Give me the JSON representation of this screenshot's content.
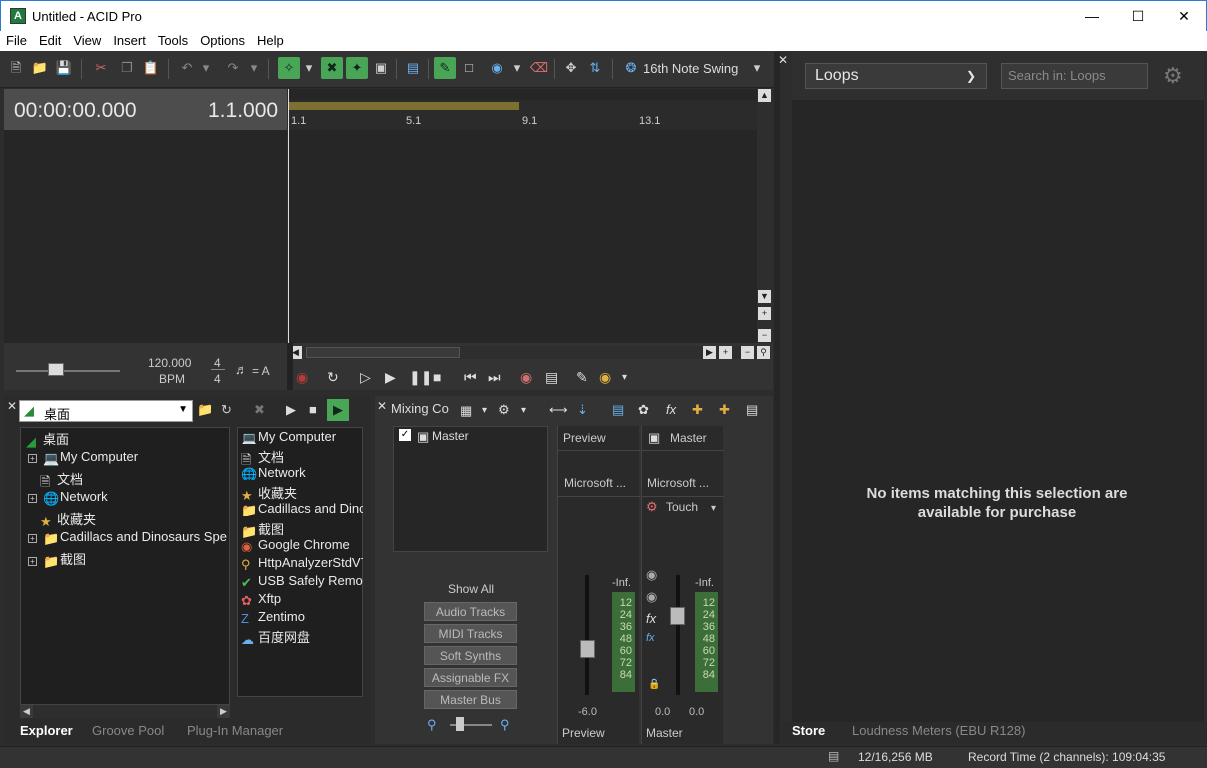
{
  "window": {
    "title": "Untitled - ACID Pro",
    "app_icon": "A"
  },
  "menu": [
    "File",
    "Edit",
    "View",
    "Insert",
    "Tools",
    "Options",
    "Help"
  ],
  "toolbar": {
    "swing_label": "16th Note Swing"
  },
  "timeline": {
    "time": "00:00:00.000",
    "measure": "1.1.000",
    "ruler_labels": [
      "1.1",
      "5.1",
      "9.1",
      "13.1"
    ],
    "tempo": "120.000",
    "tempo_unit": "BPM",
    "time_sig_top": "4",
    "time_sig_bottom": "4",
    "key": "= A"
  },
  "explorer": {
    "location": "桌面",
    "tree": [
      {
        "label": "桌面",
        "icon": "desktop-icon",
        "expand": ""
      },
      {
        "label": "My Computer",
        "icon": "computer-icon",
        "expand": "+"
      },
      {
        "label": "文档",
        "icon": "document-icon",
        "expand": ""
      },
      {
        "label": "Network",
        "icon": "network-icon",
        "expand": "+"
      },
      {
        "label": "收藏夹",
        "icon": "favorites-icon",
        "expand": ""
      },
      {
        "label": "Cadillacs and Dinosaurs Spe",
        "icon": "folder-icon",
        "expand": "+"
      },
      {
        "label": "截图",
        "icon": "folder-icon",
        "expand": "+"
      }
    ],
    "list": [
      {
        "label": "My Computer",
        "icon": "computer-icon"
      },
      {
        "label": "文档",
        "icon": "document-icon"
      },
      {
        "label": "Network",
        "icon": "network-icon"
      },
      {
        "label": "收藏夹",
        "icon": "favorites-icon"
      },
      {
        "label": "Cadillacs and Dinc",
        "icon": "folder-icon"
      },
      {
        "label": "截图",
        "icon": "folder-icon"
      },
      {
        "label": "Google Chrome",
        "icon": "chrome-icon"
      },
      {
        "label": "HttpAnalyzerStdV7",
        "icon": "app-icon"
      },
      {
        "label": "USB Safely Remov",
        "icon": "usb-icon"
      },
      {
        "label": "Xftp",
        "icon": "xftp-icon"
      },
      {
        "label": "Zentimo",
        "icon": "zentimo-icon"
      },
      {
        "label": "百度网盘",
        "icon": "cloud-icon"
      }
    ],
    "tabs": [
      "Explorer",
      "Groove Pool",
      "Plug-In Manager"
    ]
  },
  "mixer": {
    "title": "Mixing Co",
    "master_item": "Master",
    "show_all": "Show All",
    "filters": [
      "Audio Tracks",
      "MIDI Tracks",
      "Soft Synths",
      "Assignable FX",
      "Master Bus"
    ],
    "preview": {
      "label": "Preview",
      "device": "Microsoft ...",
      "peak": "-Inf.",
      "gain": "-6.0",
      "footer": "Preview"
    },
    "master": {
      "label": "Master",
      "device": "Microsoft ...",
      "automation": "Touch",
      "peak": "-Inf.",
      "gain_l": "0.0",
      "gain_r": "0.0",
      "footer": "Master"
    },
    "scale": [
      "12",
      "24",
      "36",
      "48",
      "60",
      "72",
      "84"
    ]
  },
  "store": {
    "dropdown": "Loops",
    "search_placeholder": "Search in: Loops",
    "message": "No items matching this selection are available for purchase",
    "tabs": [
      "Store",
      "Loudness Meters (EBU R128)"
    ]
  },
  "status": {
    "memory": "12/16,256 MB",
    "record_time": "Record Time (2 channels): 109:04:35"
  }
}
